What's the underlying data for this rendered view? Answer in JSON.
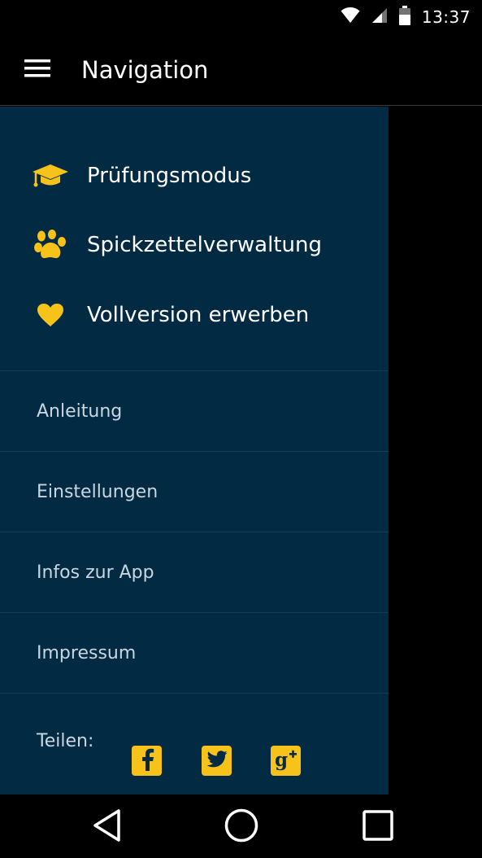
{
  "status_bar": {
    "time": "13:37",
    "icons": [
      "wifi-icon",
      "cell-signal-icon",
      "battery-icon"
    ]
  },
  "app_bar": {
    "title": "Navigation",
    "menu_icon": "hamburger-menu-icon"
  },
  "drawer": {
    "primary_items": [
      {
        "label": "Prüfungsmodus",
        "icon": "graduation-cap-icon"
      },
      {
        "label": "Spickzettelverwaltung",
        "icon": "paw-icon"
      },
      {
        "label": "Vollversion erwerben",
        "icon": "heart-icon"
      }
    ],
    "secondary_items": [
      {
        "label": "Anleitung"
      },
      {
        "label": "Einstellungen"
      },
      {
        "label": "Infos zur App"
      },
      {
        "label": "Impressum"
      }
    ],
    "share": {
      "label": "Teilen:",
      "buttons": [
        "facebook-icon",
        "twitter-icon",
        "google-plus-icon"
      ]
    }
  },
  "nav_bar": {
    "buttons": [
      "back-icon",
      "home-icon",
      "recents-icon"
    ]
  },
  "colors": {
    "drawer_bg": "#032a43",
    "accent": "#f7c31a",
    "background": "#000000"
  }
}
